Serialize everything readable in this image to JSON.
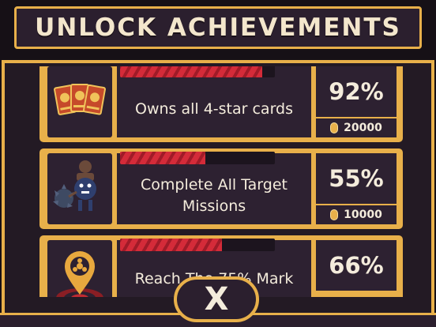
{
  "title": "UNLOCK ACHIEVEMENTS",
  "achievements": [
    {
      "icon": "cards-icon",
      "progress": 0.92,
      "percent": "92%",
      "description": "Owns all 4-star cards",
      "reward": "20000"
    },
    {
      "icon": "robot-mace-icon",
      "progress": 0.55,
      "percent": "55%",
      "description": "Complete All Target Missions",
      "reward": "10000"
    },
    {
      "icon": "map-pin-target-icon",
      "progress": 0.66,
      "percent": "66%",
      "description": "Reach The 75% Mark",
      "reward": ""
    }
  ],
  "close_label": "X",
  "colors": {
    "gold": "#e8b04a",
    "panel": "#2d2131",
    "bar_fill": "#d42b39"
  }
}
